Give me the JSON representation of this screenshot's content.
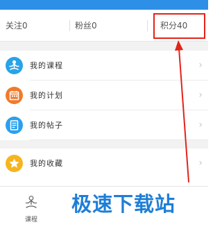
{
  "stats": {
    "follow": "关注0",
    "fans": "粉丝0",
    "points": "积分40"
  },
  "menu": {
    "items": [
      {
        "label": "我的课程",
        "icon": "meditation-icon",
        "color": "#27a3e8"
      },
      {
        "label": "我的计划",
        "icon": "calendar-icon",
        "color": "#f07b2c"
      },
      {
        "label": "我的帖子",
        "icon": "document-icon",
        "color": "#2aa0ee"
      },
      {
        "label": "我的收藏",
        "icon": "star-icon",
        "color": "#f6b51e"
      }
    ]
  },
  "tabbar": {
    "course_label": "课程"
  },
  "watermark": "极速下载站",
  "colors": {
    "topbar": "#2e8fe6",
    "highlight": "#e2231a",
    "watermark": "#1e7ed6"
  }
}
